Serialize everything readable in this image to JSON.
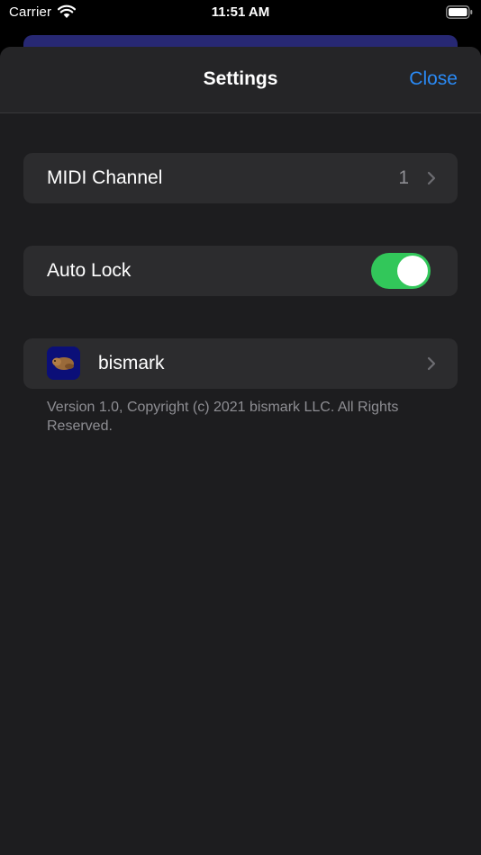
{
  "status_bar": {
    "carrier": "Carrier",
    "time": "11:51 AM",
    "icons": [
      "wifi-icon",
      "battery-icon"
    ]
  },
  "nav": {
    "title": "Settings",
    "close_label": "Close"
  },
  "rows": {
    "midi_channel": {
      "label": "MIDI Channel",
      "value": "1"
    },
    "auto_lock": {
      "label": "Auto Lock",
      "enabled": true
    },
    "about": {
      "label": "bismark",
      "icon": "bismark-app-icon"
    }
  },
  "footer": {
    "text": "Version 1.0, Copyright (c) 2021 bismark LLC. All Rights Reserved."
  },
  "colors": {
    "accent": "#2a8af5",
    "toggle_on": "#32c75a",
    "sheet_background": "#1d1d1f",
    "cell_background": "#2c2c2e",
    "secondary_text": "#8e8e93"
  }
}
